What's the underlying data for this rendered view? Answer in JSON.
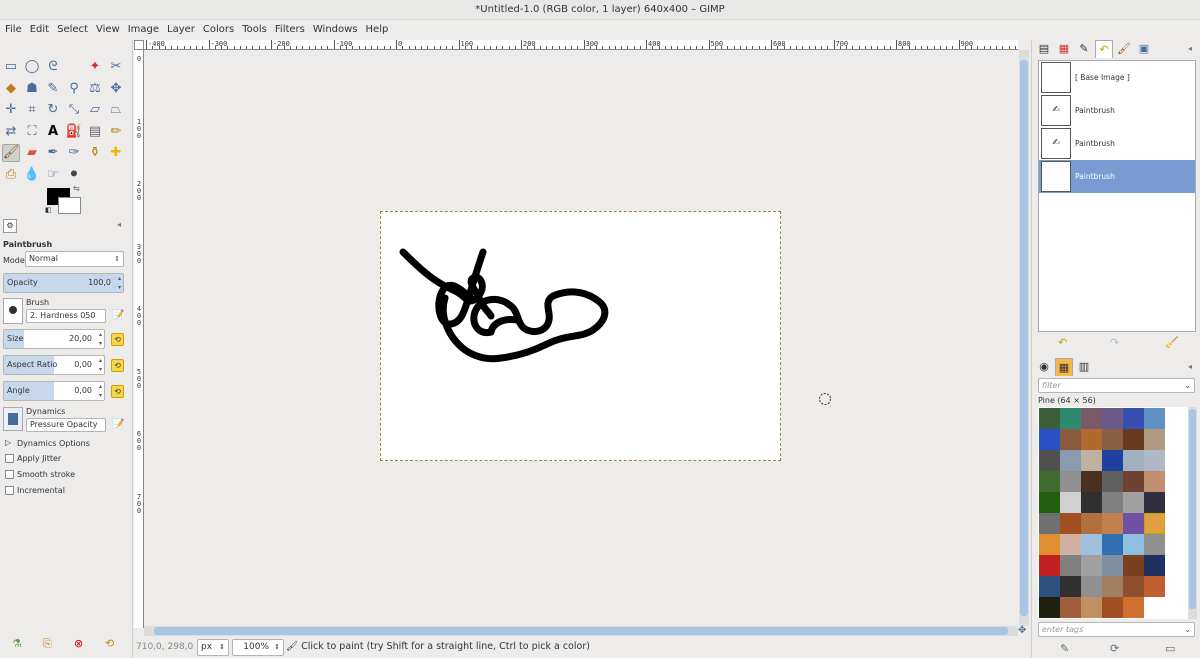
{
  "window": {
    "title": "*Untitled-1.0 (RGB color, 1 layer) 640x400 – GIMP"
  },
  "menu": [
    "File",
    "Edit",
    "Select",
    "View",
    "Image",
    "Layer",
    "Colors",
    "Tools",
    "Filters",
    "Windows",
    "Help"
  ],
  "tool_options": {
    "title": "Paintbrush",
    "mode_label": "Mode:",
    "mode_value": "Normal",
    "opacity_label": "Opacity",
    "opacity_value": "100,0",
    "opacity_fraction": 1.0,
    "brush_label": "Brush",
    "brush_value": "2. Hardness 050",
    "size_label": "Size",
    "size_value": "20,00",
    "size_fraction": 0.2,
    "aspect_label": "Aspect Ratio",
    "aspect_value": "0,00",
    "aspect_fraction": 0.5,
    "angle_label": "Angle",
    "angle_value": "0,00",
    "angle_fraction": 0.5,
    "dynamics_label": "Dynamics",
    "dynamics_value": "Pressure Opacity",
    "dynamics_options": "Dynamics Options",
    "apply_jitter": "Apply Jitter",
    "smooth_stroke": "Smooth stroke",
    "incremental": "Incremental"
  },
  "colors": {
    "foreground": "#000000",
    "background": "#ffffff",
    "selection_accent": "#7a9bd1"
  },
  "ruler": {
    "h_labels": [
      "-400",
      "-300",
      "-200",
      "-100",
      "0",
      "100",
      "200",
      "300",
      "400",
      "500",
      "600",
      "700",
      "800",
      "900",
      "1000"
    ],
    "v_labels": [
      "0",
      "100",
      "200",
      "300",
      "400",
      "500",
      "600",
      "700"
    ]
  },
  "status": {
    "coords": "710,0, 298,0",
    "unit": "px",
    "zoom": "100%",
    "message": "Click to paint (try Shift for a straight line, Ctrl to pick a color)"
  },
  "undo_history": [
    {
      "label": "[ Base Image ]",
      "icon": "base-image"
    },
    {
      "label": "Paintbrush",
      "icon": "paintbrush-icon"
    },
    {
      "label": "Paintbrush",
      "icon": "paintbrush-icon"
    },
    {
      "label": "Paintbrush",
      "icon": "paintbrush-icon",
      "selected": true
    }
  ],
  "patterns": {
    "filter_placeholder": "filter",
    "selected_name": "Pine (64 × 56)",
    "tags_placeholder": "enter tags"
  }
}
